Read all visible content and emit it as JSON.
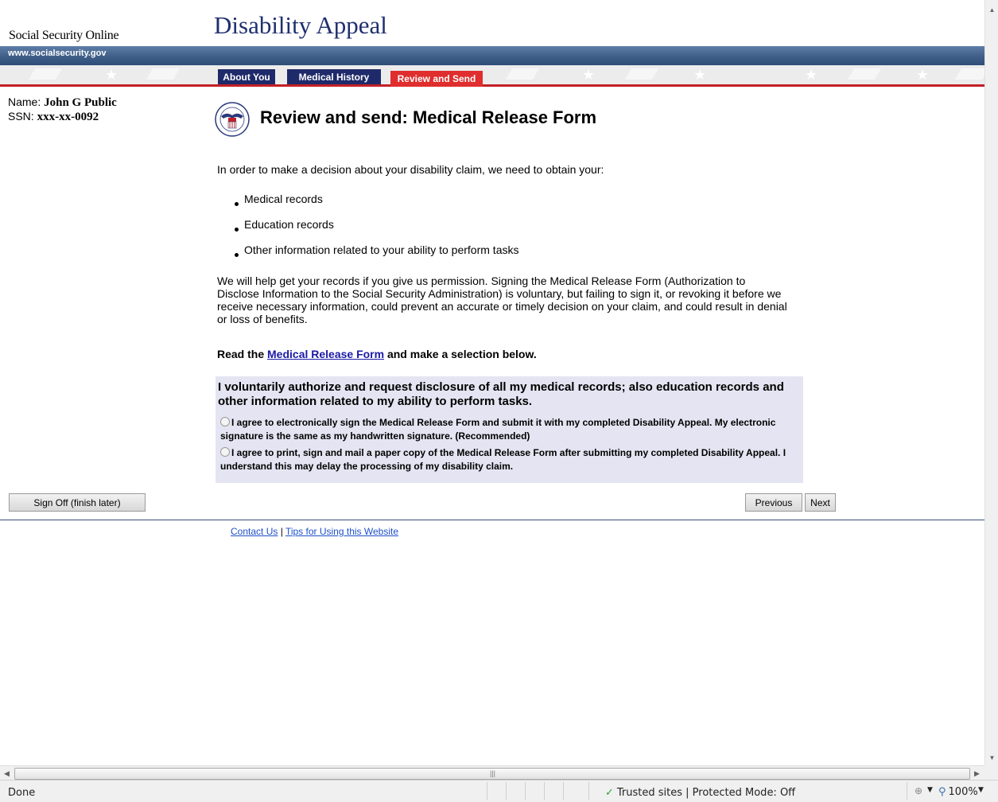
{
  "header": {
    "site_name": "Social Security Online",
    "app_title": "Disability Appeal",
    "url": "www.socialsecurity.gov"
  },
  "tabs": [
    {
      "label": "About You",
      "state": "completed"
    },
    {
      "label": "Medical History",
      "state": "completed"
    },
    {
      "label": "Review and Send",
      "state": "active"
    }
  ],
  "user": {
    "name_label": "Name:",
    "name": "John G Public",
    "ssn_label": "SSN:",
    "ssn": "xxx-xx-0092"
  },
  "main": {
    "title": "Review and send: Medical Release Form",
    "intro": "In order to make a decision about your disability claim, we need to obtain your:",
    "records": [
      "Medical records",
      "Education records",
      "Other information related to your ability to perform tasks"
    ],
    "paragraph": "We will help get your records if you give us permission. Signing the Medical Release Form (Authorization to Disclose Information to the Social Security Administration) is voluntary, but failing to sign it, or revoking it before we receive necessary information, could prevent an accurate or timely decision on your claim, and could result in denial or loss of benefits.",
    "read_prefix": "Read the",
    "read_link": "Medical Release Form",
    "read_suffix": "and make a selection below."
  },
  "consent": {
    "heading": "I voluntarily authorize and request disclosure of all my medical records; also education records and other information related to my ability to perform tasks.",
    "options": [
      {
        "label": "I agree to electronically sign the Medical Release Form and submit it with my completed Disability Appeal. My electronic signature is the same as my handwritten signature. (Recommended)",
        "selected": false
      },
      {
        "label": "I agree to print, sign and mail a paper copy of the Medical Release Form after submitting my completed Disability Appeal. I understand this may delay the processing of my disability claim.",
        "selected": false
      }
    ]
  },
  "buttons": {
    "sign_off": "Sign Off (finish later)",
    "previous": "Previous",
    "next": "Next"
  },
  "footer": {
    "contact": "Contact Us",
    "separator": "|",
    "tips": "Tips for Using this Website"
  },
  "statusbar": {
    "status": "Done",
    "zone": "Trusted sites | Protected Mode: Off",
    "zoom": "100%"
  },
  "colors": {
    "title_navy": "#1f2f6e",
    "tab_navy": "#1f2a6a",
    "tab_red": "#e02d2d",
    "rule_red": "#c22026",
    "consent_bg": "#e4e4f2",
    "link_blue": "#1a1aa6"
  }
}
